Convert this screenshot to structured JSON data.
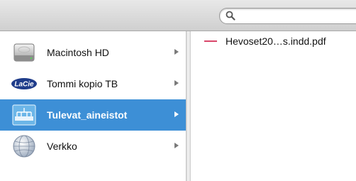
{
  "search": {
    "placeholder": "",
    "value": ""
  },
  "sidebar": {
    "items": [
      {
        "label": "Macintosh HD",
        "icon": "hard-drive-icon",
        "selected": false
      },
      {
        "label": "Tommi kopio TB",
        "icon": "lacie-drive-icon",
        "selected": false
      },
      {
        "label": "Tulevat_aineistot",
        "icon": "network-volume-icon",
        "selected": true
      },
      {
        "label": "Verkko",
        "icon": "network-globe-icon",
        "selected": false
      }
    ],
    "brand_badge": "LaCie"
  },
  "files": [
    {
      "name": "Hevoset20…s.indd.pdf",
      "icon": "pdf-file-icon"
    }
  ],
  "colors": {
    "selection": "#3d8fd6",
    "file_accent": "#d9466a"
  }
}
